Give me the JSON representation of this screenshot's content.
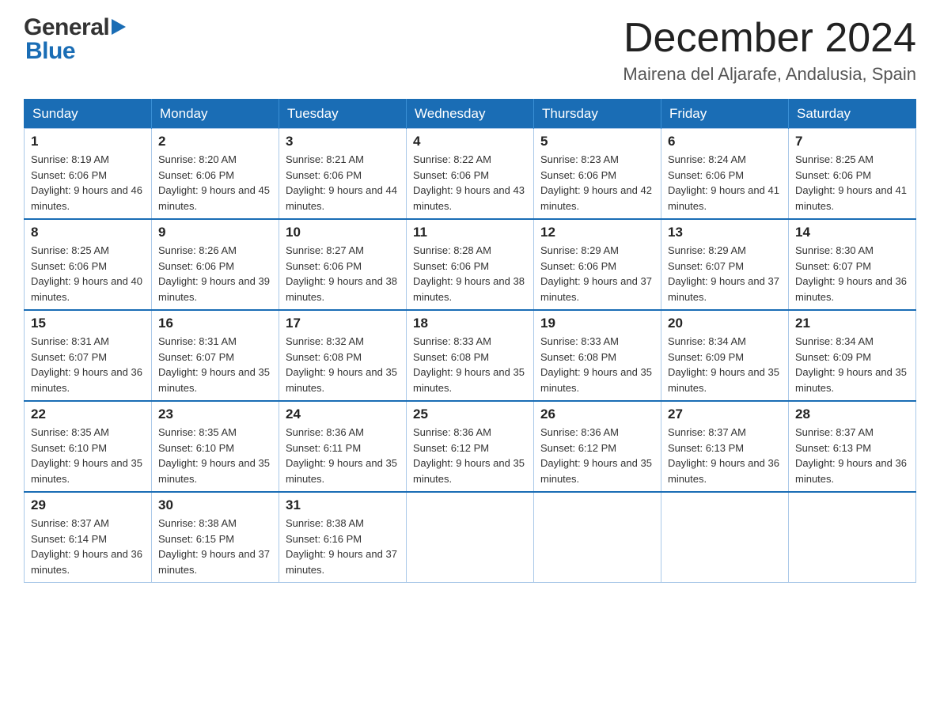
{
  "header": {
    "logo_general": "General",
    "logo_blue": "Blue",
    "month_title": "December 2024",
    "location": "Mairena del Aljarafe, Andalusia, Spain"
  },
  "weekdays": [
    "Sunday",
    "Monday",
    "Tuesday",
    "Wednesday",
    "Thursday",
    "Friday",
    "Saturday"
  ],
  "weeks": [
    [
      {
        "day": "1",
        "sunrise": "8:19 AM",
        "sunset": "6:06 PM",
        "daylight": "9 hours and 46 minutes."
      },
      {
        "day": "2",
        "sunrise": "8:20 AM",
        "sunset": "6:06 PM",
        "daylight": "9 hours and 45 minutes."
      },
      {
        "day": "3",
        "sunrise": "8:21 AM",
        "sunset": "6:06 PM",
        "daylight": "9 hours and 44 minutes."
      },
      {
        "day": "4",
        "sunrise": "8:22 AM",
        "sunset": "6:06 PM",
        "daylight": "9 hours and 43 minutes."
      },
      {
        "day": "5",
        "sunrise": "8:23 AM",
        "sunset": "6:06 PM",
        "daylight": "9 hours and 42 minutes."
      },
      {
        "day": "6",
        "sunrise": "8:24 AM",
        "sunset": "6:06 PM",
        "daylight": "9 hours and 41 minutes."
      },
      {
        "day": "7",
        "sunrise": "8:25 AM",
        "sunset": "6:06 PM",
        "daylight": "9 hours and 41 minutes."
      }
    ],
    [
      {
        "day": "8",
        "sunrise": "8:25 AM",
        "sunset": "6:06 PM",
        "daylight": "9 hours and 40 minutes."
      },
      {
        "day": "9",
        "sunrise": "8:26 AM",
        "sunset": "6:06 PM",
        "daylight": "9 hours and 39 minutes."
      },
      {
        "day": "10",
        "sunrise": "8:27 AM",
        "sunset": "6:06 PM",
        "daylight": "9 hours and 38 minutes."
      },
      {
        "day": "11",
        "sunrise": "8:28 AM",
        "sunset": "6:06 PM",
        "daylight": "9 hours and 38 minutes."
      },
      {
        "day": "12",
        "sunrise": "8:29 AM",
        "sunset": "6:06 PM",
        "daylight": "9 hours and 37 minutes."
      },
      {
        "day": "13",
        "sunrise": "8:29 AM",
        "sunset": "6:07 PM",
        "daylight": "9 hours and 37 minutes."
      },
      {
        "day": "14",
        "sunrise": "8:30 AM",
        "sunset": "6:07 PM",
        "daylight": "9 hours and 36 minutes."
      }
    ],
    [
      {
        "day": "15",
        "sunrise": "8:31 AM",
        "sunset": "6:07 PM",
        "daylight": "9 hours and 36 minutes."
      },
      {
        "day": "16",
        "sunrise": "8:31 AM",
        "sunset": "6:07 PM",
        "daylight": "9 hours and 35 minutes."
      },
      {
        "day": "17",
        "sunrise": "8:32 AM",
        "sunset": "6:08 PM",
        "daylight": "9 hours and 35 minutes."
      },
      {
        "day": "18",
        "sunrise": "8:33 AM",
        "sunset": "6:08 PM",
        "daylight": "9 hours and 35 minutes."
      },
      {
        "day": "19",
        "sunrise": "8:33 AM",
        "sunset": "6:08 PM",
        "daylight": "9 hours and 35 minutes."
      },
      {
        "day": "20",
        "sunrise": "8:34 AM",
        "sunset": "6:09 PM",
        "daylight": "9 hours and 35 minutes."
      },
      {
        "day": "21",
        "sunrise": "8:34 AM",
        "sunset": "6:09 PM",
        "daylight": "9 hours and 35 minutes."
      }
    ],
    [
      {
        "day": "22",
        "sunrise": "8:35 AM",
        "sunset": "6:10 PM",
        "daylight": "9 hours and 35 minutes."
      },
      {
        "day": "23",
        "sunrise": "8:35 AM",
        "sunset": "6:10 PM",
        "daylight": "9 hours and 35 minutes."
      },
      {
        "day": "24",
        "sunrise": "8:36 AM",
        "sunset": "6:11 PM",
        "daylight": "9 hours and 35 minutes."
      },
      {
        "day": "25",
        "sunrise": "8:36 AM",
        "sunset": "6:12 PM",
        "daylight": "9 hours and 35 minutes."
      },
      {
        "day": "26",
        "sunrise": "8:36 AM",
        "sunset": "6:12 PM",
        "daylight": "9 hours and 35 minutes."
      },
      {
        "day": "27",
        "sunrise": "8:37 AM",
        "sunset": "6:13 PM",
        "daylight": "9 hours and 36 minutes."
      },
      {
        "day": "28",
        "sunrise": "8:37 AM",
        "sunset": "6:13 PM",
        "daylight": "9 hours and 36 minutes."
      }
    ],
    [
      {
        "day": "29",
        "sunrise": "8:37 AM",
        "sunset": "6:14 PM",
        "daylight": "9 hours and 36 minutes."
      },
      {
        "day": "30",
        "sunrise": "8:38 AM",
        "sunset": "6:15 PM",
        "daylight": "9 hours and 37 minutes."
      },
      {
        "day": "31",
        "sunrise": "8:38 AM",
        "sunset": "6:16 PM",
        "daylight": "9 hours and 37 minutes."
      },
      null,
      null,
      null,
      null
    ]
  ]
}
